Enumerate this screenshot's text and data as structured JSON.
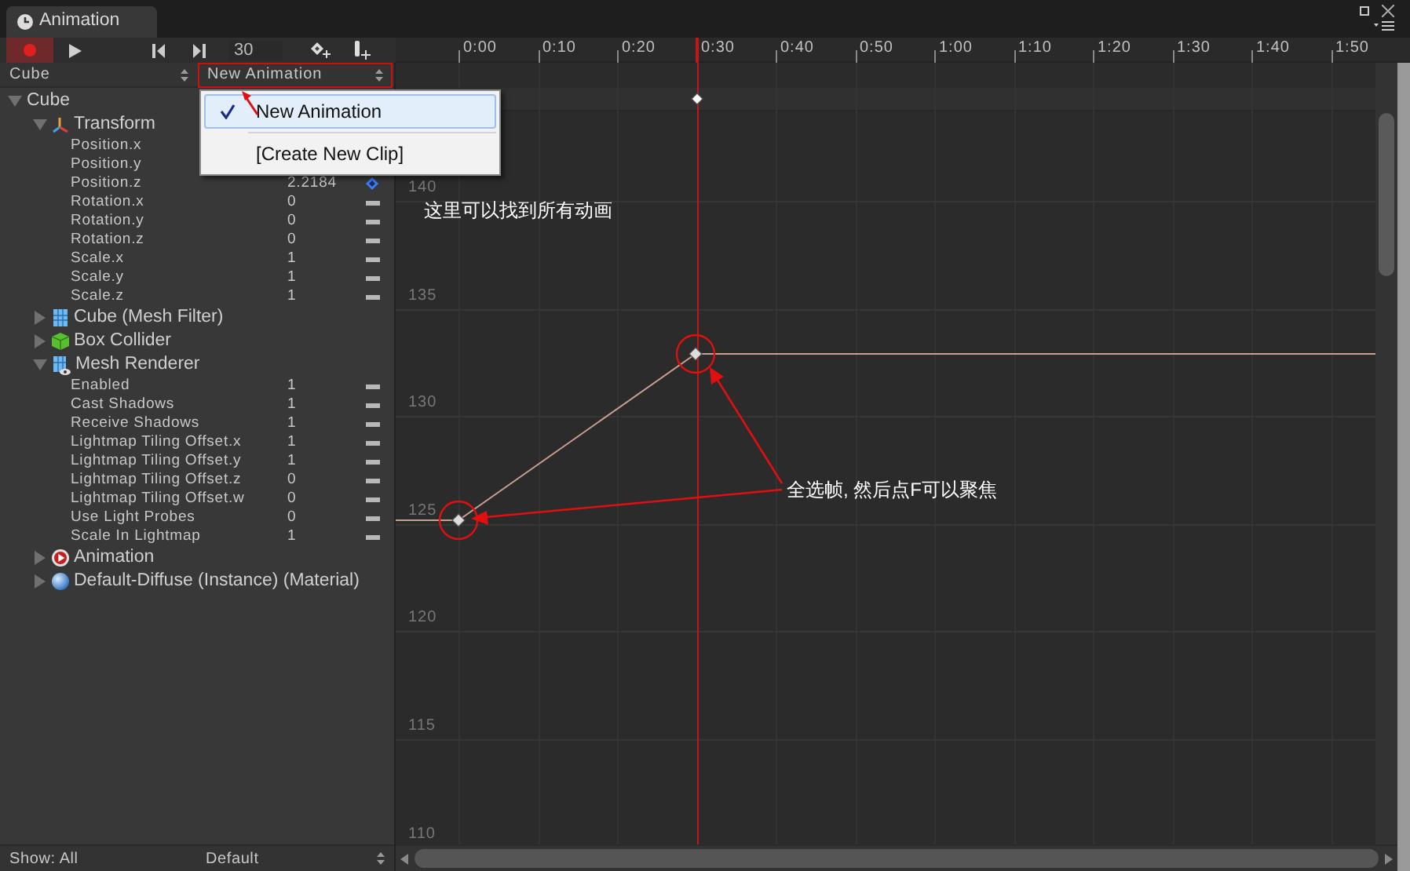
{
  "window": {
    "tab": "Animation"
  },
  "toolbar": {
    "record_on": true,
    "frame": "30"
  },
  "timeline": {
    "ticks": [
      {
        "label": "0:00",
        "playhead": false
      },
      {
        "label": "0:10",
        "playhead": false
      },
      {
        "label": "0:20",
        "playhead": false
      },
      {
        "label": "0:30",
        "playhead": true
      },
      {
        "label": "0:40",
        "playhead": false
      },
      {
        "label": "0:50",
        "playhead": false
      },
      {
        "label": "1:00",
        "playhead": false
      },
      {
        "label": "1:10",
        "playhead": false
      },
      {
        "label": "1:20",
        "playhead": false
      },
      {
        "label": "1:30",
        "playhead": false
      },
      {
        "label": "1:40",
        "playhead": false
      },
      {
        "label": "1:50",
        "playhead": false
      }
    ]
  },
  "selectors": {
    "object": "Cube",
    "clip": "New Animation"
  },
  "clip_menu": {
    "items": [
      {
        "label": "New Animation",
        "selected": true
      },
      {
        "label": "[Create New Clip]",
        "selected": false
      }
    ]
  },
  "tree": [
    {
      "label": "Cube",
      "kind": "object",
      "expanded": true,
      "children": [
        {
          "label": "Transform",
          "kind": "transform",
          "expanded": true,
          "children": [
            {
              "label": "Position.x",
              "kind": "property"
            },
            {
              "label": "Position.y",
              "kind": "property"
            },
            {
              "label": "Position.z",
              "kind": "property",
              "value": "2.2184",
              "keyed": true
            },
            {
              "label": "Rotation.x",
              "kind": "property",
              "value": "0",
              "keyed": false
            },
            {
              "label": "Rotation.y",
              "kind": "property",
              "value": "0",
              "keyed": false
            },
            {
              "label": "Rotation.z",
              "kind": "property",
              "value": "0",
              "keyed": false
            },
            {
              "label": "Scale.x",
              "kind": "property",
              "value": "1",
              "keyed": false
            },
            {
              "label": "Scale.y",
              "kind": "property",
              "value": "1",
              "keyed": false
            },
            {
              "label": "Scale.z",
              "kind": "property",
              "value": "1",
              "keyed": false
            }
          ]
        },
        {
          "label": "Cube (Mesh Filter)",
          "kind": "mesh-filter",
          "expanded": false
        },
        {
          "label": "Box Collider",
          "kind": "box-collider",
          "expanded": false
        },
        {
          "label": "Mesh Renderer",
          "kind": "mesh-renderer",
          "expanded": true,
          "children": [
            {
              "label": "Enabled",
              "kind": "property",
              "value": "1",
              "keyed": false
            },
            {
              "label": "Cast Shadows",
              "kind": "property",
              "value": "1",
              "keyed": false
            },
            {
              "label": "Receive Shadows",
              "kind": "property",
              "value": "1",
              "keyed": false
            },
            {
              "label": "Lightmap Tiling Offset.x",
              "kind": "property",
              "value": "1",
              "keyed": false
            },
            {
              "label": "Lightmap Tiling Offset.y",
              "kind": "property",
              "value": "1",
              "keyed": false
            },
            {
              "label": "Lightmap Tiling Offset.z",
              "kind": "property",
              "value": "0",
              "keyed": false
            },
            {
              "label": "Lightmap Tiling Offset.w",
              "kind": "property",
              "value": "0",
              "keyed": false
            },
            {
              "label": "Use Light Probes",
              "kind": "property",
              "value": "0",
              "keyed": false
            },
            {
              "label": "Scale In Lightmap",
              "kind": "property",
              "value": "1",
              "keyed": false
            }
          ]
        },
        {
          "label": "Animation",
          "kind": "animation",
          "expanded": false
        },
        {
          "label": "Default-Diffuse (Instance) (Material)",
          "kind": "material",
          "expanded": false
        }
      ]
    }
  ],
  "curve": {
    "y_labels": [
      "140",
      "135",
      "130",
      "125",
      "120",
      "115",
      "110"
    ]
  },
  "annotations": [
    {
      "text": "这里可以找到所有动画"
    },
    {
      "text": "全选帧, 然后点F可以聚焦"
    }
  ],
  "bottom": {
    "show": "Show: All",
    "mode": "Default"
  }
}
